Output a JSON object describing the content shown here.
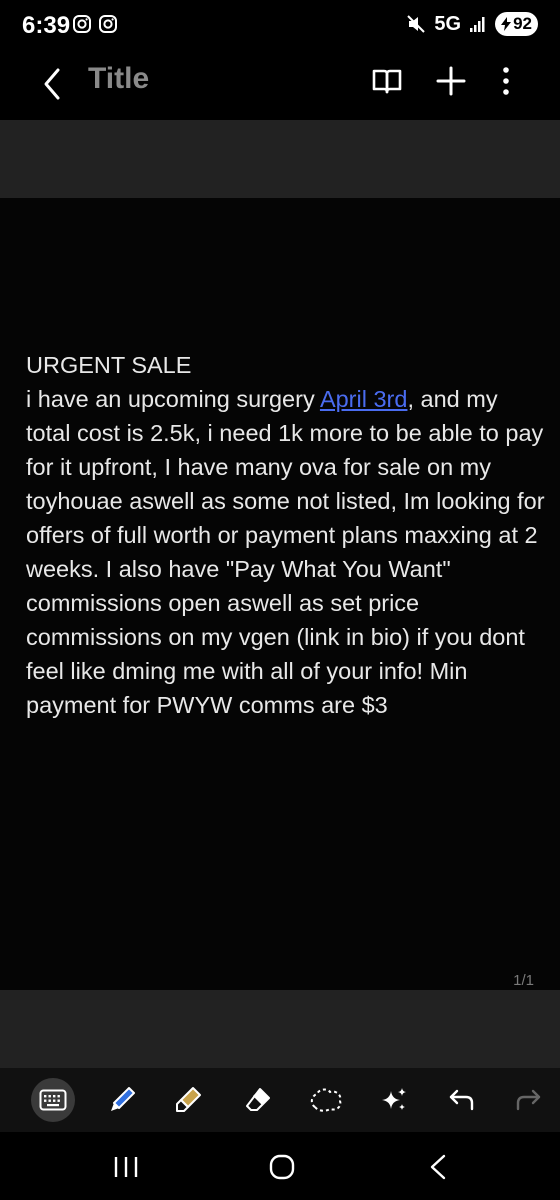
{
  "status_bar": {
    "time": "6:39",
    "network": "5G",
    "battery": "92",
    "left_icons": [
      "instagram-icon",
      "instagram-icon"
    ],
    "right_icons": [
      "mute-icon",
      "signal-icon"
    ]
  },
  "app_bar": {
    "title": "Title",
    "icons": [
      "back-icon",
      "read-mode-icon",
      "add-icon",
      "more-options-icon"
    ]
  },
  "note": {
    "line1": "URGENT SALE",
    "text_before_link": "i have an upcoming surgery ",
    "link_text": "April 3rd",
    "text_after_link": ", and my total cost is 2.5k, i need 1k more to be able to pay for it upfront, I have many ova for sale on my toyhouae aswell as some not listed, Im looking for offers of full worth or payment plans maxxing at 2 weeks. I also have \"Pay What You Want\" commissions open aswell as set price commissions on my vgen (link in bio) if you dont feel like dming me with all of your info! Min payment for PWYW comms are $3",
    "link_color": "#4a6cf0"
  },
  "page_indicator": "1/1",
  "toolbar": {
    "tools": [
      "keyboard-icon",
      "pen-icon",
      "highlighter-icon",
      "eraser-icon",
      "lasso-icon",
      "ai-sparkle-icon",
      "undo-icon",
      "redo-icon"
    ],
    "active_tool": "keyboard-icon"
  },
  "nav_bar": {
    "buttons": [
      "recent-apps-icon",
      "home-icon",
      "back-icon"
    ]
  }
}
